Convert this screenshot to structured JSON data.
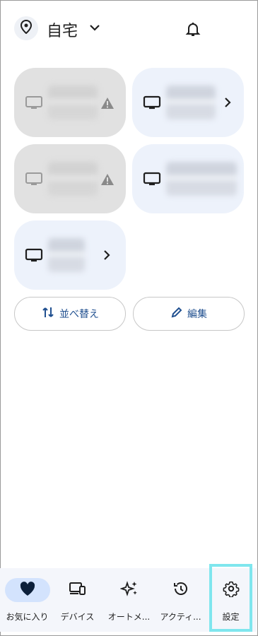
{
  "header": {
    "home_name": "自宅",
    "pin_icon": "location-pin-icon",
    "dropdown_icon": "chevron-down-icon",
    "notifications_icon": "bell-icon"
  },
  "devices": [
    {
      "state": "offline",
      "icon": "tv-icon",
      "status_icon": "warning-icon",
      "name": "",
      "sub": ""
    },
    {
      "state": "online",
      "icon": "tv-icon",
      "status_icon": "chevron-right-icon",
      "name": "",
      "sub": ""
    },
    {
      "state": "offline",
      "icon": "tv-icon",
      "status_icon": "warning-icon",
      "name": "",
      "sub": ""
    },
    {
      "state": "online",
      "icon": "tv-icon",
      "status_icon": "",
      "name": "",
      "sub": ""
    },
    {
      "state": "online",
      "icon": "tv-icon",
      "status_icon": "chevron-right-icon",
      "name": "",
      "sub": ""
    }
  ],
  "actions": {
    "reorder_label": "並べ替え",
    "edit_label": "編集"
  },
  "nav": {
    "items": [
      {
        "label": "お気に入り",
        "icon": "heart-icon",
        "active": true
      },
      {
        "label": "デバイス",
        "icon": "devices-icon",
        "active": false
      },
      {
        "label": "オートメ...",
        "icon": "sparkle-icon",
        "active": false
      },
      {
        "label": "アクティ...",
        "icon": "history-icon",
        "active": false
      },
      {
        "label": "設定",
        "icon": "gear-icon",
        "active": false
      }
    ]
  },
  "colors": {
    "accent": "#1f4f8f",
    "tile_on": "#edf2fb",
    "tile_off": "#e1e1e1",
    "highlight": "#7fe6ee"
  }
}
